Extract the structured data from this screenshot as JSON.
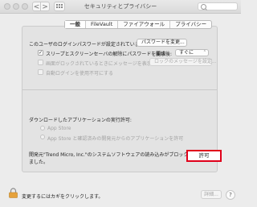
{
  "window": {
    "title": "セキュリティとプライバシー",
    "nav_back": "<",
    "nav_forward": ">"
  },
  "tabs": [
    {
      "label": "一般",
      "active": true
    },
    {
      "label": "FileVault",
      "active": false
    },
    {
      "label": "ファイアウォール",
      "active": false
    },
    {
      "label": "プライバシー",
      "active": false
    }
  ],
  "login": {
    "password_text": "このユーザのログインパスワードが設定されています",
    "change_password_button": "パスワードを変更...",
    "require_password_label": "スリープとスクリーンセーバの解除にパスワードを要求",
    "require_password_checked": "✓",
    "start_label": "開始後:",
    "start_value": "すぐに",
    "show_message_label": "画面がロックされているときにメッセージを表示",
    "set_lock_message_button": "ロックのメッセージを設定...",
    "disable_autologin_label": "自動ログインを使用不可にする"
  },
  "downloads": {
    "heading": "ダウンロードしたアプリケーションの実行許可:",
    "options": [
      {
        "label": "App Store"
      },
      {
        "label": "App Store と確認済みの開発元からのアプリケーションを許可"
      }
    ],
    "blocked_message_line1": "開発元\"Trend Micro, Inc.\"のシステムソフトウェアの読み込みがブロックされ",
    "blocked_message_line2": "ました。",
    "allow_button": "許可"
  },
  "footer": {
    "lock_text": "変更するにはカギをクリックします。",
    "details_button": "詳細...",
    "help_button": "?"
  },
  "colors": {
    "highlight_border": "#e0001a",
    "background": "#ececec"
  }
}
